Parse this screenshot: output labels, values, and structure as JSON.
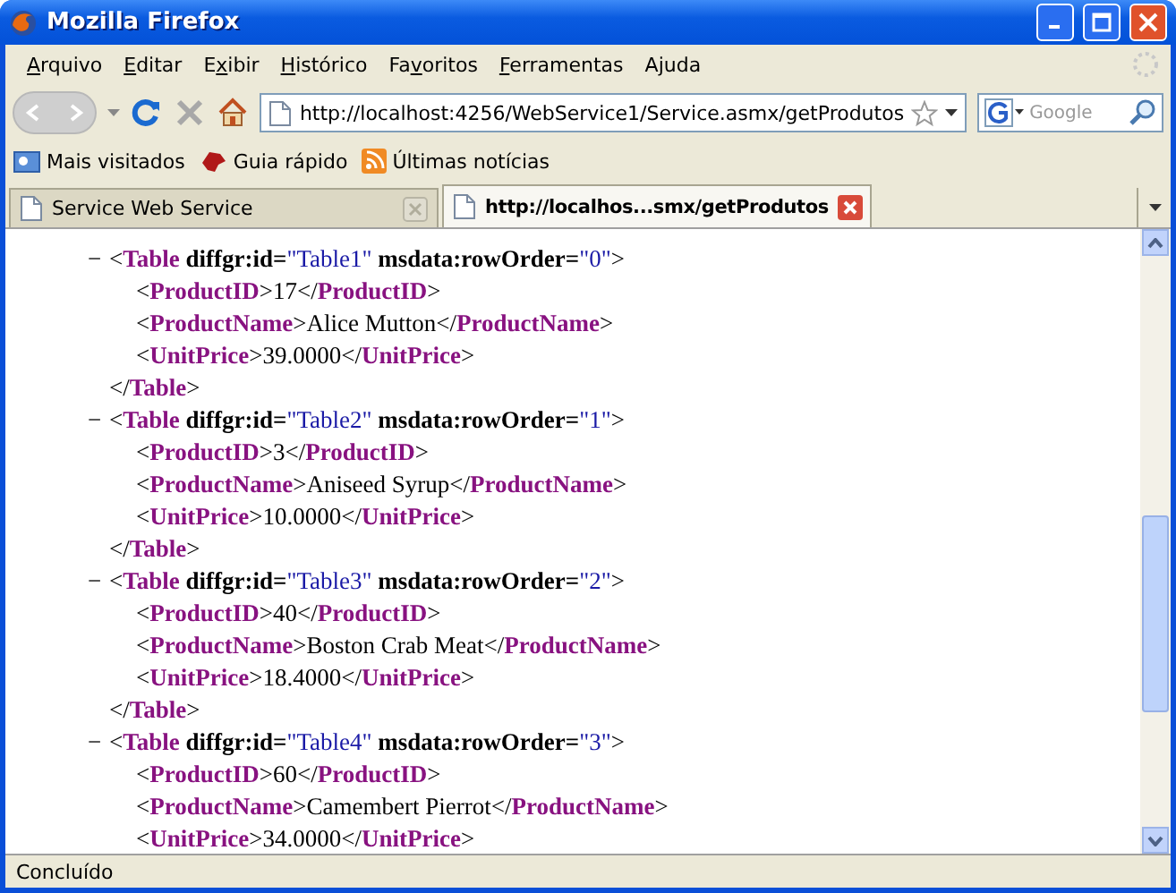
{
  "window": {
    "title": "Mozilla Firefox"
  },
  "menu": [
    {
      "key": "A",
      "post": "rquivo"
    },
    {
      "key": "E",
      "post": "ditar"
    },
    {
      "pre": "E",
      "key": "x",
      "post": "ibir"
    },
    {
      "key": "H",
      "post": "istórico"
    },
    {
      "pre": "Fa",
      "key": "v",
      "post": "oritos"
    },
    {
      "key": "F",
      "post": "erramentas"
    },
    {
      "pre": "A",
      "key": "j",
      "post": "uda"
    }
  ],
  "address_bar": {
    "value": "http://localhost:4256/WebService1/Service.asmx/getProdutos"
  },
  "search": {
    "placeholder": "Google"
  },
  "bookmarks": [
    {
      "label": "Mais visitados",
      "kind": "folder"
    },
    {
      "label": "Guia rápido",
      "kind": "guide"
    },
    {
      "label": "Últimas notícias",
      "kind": "feed"
    }
  ],
  "tabs": [
    {
      "label": "Service Web Service",
      "selected": false
    },
    {
      "label": "http://localhos...smx/getProdutos",
      "selected": true
    }
  ],
  "document": [
    {
      "toggle": "−",
      "open": [
        {
          "kind": "punct",
          "text": "<"
        },
        {
          "kind": "tag",
          "text": "Table"
        },
        {
          "kind": "attr",
          "text": " diffgr:id="
        },
        {
          "kind": "value",
          "text": "\"Table1\""
        },
        {
          "kind": "attr",
          "text": " msdata:rowOrder="
        },
        {
          "kind": "value",
          "text": "\"0\""
        },
        {
          "kind": "punct",
          "text": ">"
        }
      ],
      "children": [
        [
          {
            "kind": "punct",
            "text": "<"
          },
          {
            "kind": "tag",
            "text": "ProductID"
          },
          {
            "kind": "punct",
            "text": ">"
          },
          {
            "kind": "text",
            "text": "17"
          },
          {
            "kind": "punct",
            "text": "</"
          },
          {
            "kind": "tag",
            "text": "ProductID"
          },
          {
            "kind": "punct",
            "text": ">"
          }
        ],
        [
          {
            "kind": "punct",
            "text": "<"
          },
          {
            "kind": "tag",
            "text": "ProductName"
          },
          {
            "kind": "punct",
            "text": ">"
          },
          {
            "kind": "text",
            "text": "Alice Mutton"
          },
          {
            "kind": "punct",
            "text": "</"
          },
          {
            "kind": "tag",
            "text": "ProductName"
          },
          {
            "kind": "punct",
            "text": ">"
          }
        ],
        [
          {
            "kind": "punct",
            "text": "<"
          },
          {
            "kind": "tag",
            "text": "UnitPrice"
          },
          {
            "kind": "punct",
            "text": ">"
          },
          {
            "kind": "text",
            "text": "39.0000"
          },
          {
            "kind": "punct",
            "text": "</"
          },
          {
            "kind": "tag",
            "text": "UnitPrice"
          },
          {
            "kind": "punct",
            "text": ">"
          }
        ]
      ],
      "close": [
        {
          "kind": "punct",
          "text": "</"
        },
        {
          "kind": "tag",
          "text": "Table"
        },
        {
          "kind": "punct",
          "text": ">"
        }
      ]
    },
    {
      "toggle": "−",
      "open": [
        {
          "kind": "punct",
          "text": "<"
        },
        {
          "kind": "tag",
          "text": "Table"
        },
        {
          "kind": "attr",
          "text": " diffgr:id="
        },
        {
          "kind": "value",
          "text": "\"Table2\""
        },
        {
          "kind": "attr",
          "text": " msdata:rowOrder="
        },
        {
          "kind": "value",
          "text": "\"1\""
        },
        {
          "kind": "punct",
          "text": ">"
        }
      ],
      "children": [
        [
          {
            "kind": "punct",
            "text": "<"
          },
          {
            "kind": "tag",
            "text": "ProductID"
          },
          {
            "kind": "punct",
            "text": ">"
          },
          {
            "kind": "text",
            "text": "3"
          },
          {
            "kind": "punct",
            "text": "</"
          },
          {
            "kind": "tag",
            "text": "ProductID"
          },
          {
            "kind": "punct",
            "text": ">"
          }
        ],
        [
          {
            "kind": "punct",
            "text": "<"
          },
          {
            "kind": "tag",
            "text": "ProductName"
          },
          {
            "kind": "punct",
            "text": ">"
          },
          {
            "kind": "text",
            "text": "Aniseed Syrup"
          },
          {
            "kind": "punct",
            "text": "</"
          },
          {
            "kind": "tag",
            "text": "ProductName"
          },
          {
            "kind": "punct",
            "text": ">"
          }
        ],
        [
          {
            "kind": "punct",
            "text": "<"
          },
          {
            "kind": "tag",
            "text": "UnitPrice"
          },
          {
            "kind": "punct",
            "text": ">"
          },
          {
            "kind": "text",
            "text": "10.0000"
          },
          {
            "kind": "punct",
            "text": "</"
          },
          {
            "kind": "tag",
            "text": "UnitPrice"
          },
          {
            "kind": "punct",
            "text": ">"
          }
        ]
      ],
      "close": [
        {
          "kind": "punct",
          "text": "</"
        },
        {
          "kind": "tag",
          "text": "Table"
        },
        {
          "kind": "punct",
          "text": ">"
        }
      ]
    },
    {
      "toggle": "−",
      "open": [
        {
          "kind": "punct",
          "text": "<"
        },
        {
          "kind": "tag",
          "text": "Table"
        },
        {
          "kind": "attr",
          "text": " diffgr:id="
        },
        {
          "kind": "value",
          "text": "\"Table3\""
        },
        {
          "kind": "attr",
          "text": " msdata:rowOrder="
        },
        {
          "kind": "value",
          "text": "\"2\""
        },
        {
          "kind": "punct",
          "text": ">"
        }
      ],
      "children": [
        [
          {
            "kind": "punct",
            "text": "<"
          },
          {
            "kind": "tag",
            "text": "ProductID"
          },
          {
            "kind": "punct",
            "text": ">"
          },
          {
            "kind": "text",
            "text": "40"
          },
          {
            "kind": "punct",
            "text": "</"
          },
          {
            "kind": "tag",
            "text": "ProductID"
          },
          {
            "kind": "punct",
            "text": ">"
          }
        ],
        [
          {
            "kind": "punct",
            "text": "<"
          },
          {
            "kind": "tag",
            "text": "ProductName"
          },
          {
            "kind": "punct",
            "text": ">"
          },
          {
            "kind": "text",
            "text": "Boston Crab Meat"
          },
          {
            "kind": "punct",
            "text": "</"
          },
          {
            "kind": "tag",
            "text": "ProductName"
          },
          {
            "kind": "punct",
            "text": ">"
          }
        ],
        [
          {
            "kind": "punct",
            "text": "<"
          },
          {
            "kind": "tag",
            "text": "UnitPrice"
          },
          {
            "kind": "punct",
            "text": ">"
          },
          {
            "kind": "text",
            "text": "18.4000"
          },
          {
            "kind": "punct",
            "text": "</"
          },
          {
            "kind": "tag",
            "text": "UnitPrice"
          },
          {
            "kind": "punct",
            "text": ">"
          }
        ]
      ],
      "close": [
        {
          "kind": "punct",
          "text": "</"
        },
        {
          "kind": "tag",
          "text": "Table"
        },
        {
          "kind": "punct",
          "text": ">"
        }
      ]
    },
    {
      "toggle": "−",
      "open": [
        {
          "kind": "punct",
          "text": "<"
        },
        {
          "kind": "tag",
          "text": "Table"
        },
        {
          "kind": "attr",
          "text": " diffgr:id="
        },
        {
          "kind": "value",
          "text": "\"Table4\""
        },
        {
          "kind": "attr",
          "text": " msdata:rowOrder="
        },
        {
          "kind": "value",
          "text": "\"3\""
        },
        {
          "kind": "punct",
          "text": ">"
        }
      ],
      "children": [
        [
          {
            "kind": "punct",
            "text": "<"
          },
          {
            "kind": "tag",
            "text": "ProductID"
          },
          {
            "kind": "punct",
            "text": ">"
          },
          {
            "kind": "text",
            "text": "60"
          },
          {
            "kind": "punct",
            "text": "</"
          },
          {
            "kind": "tag",
            "text": "ProductID"
          },
          {
            "kind": "punct",
            "text": ">"
          }
        ],
        [
          {
            "kind": "punct",
            "text": "<"
          },
          {
            "kind": "tag",
            "text": "ProductName"
          },
          {
            "kind": "punct",
            "text": ">"
          },
          {
            "kind": "text",
            "text": "Camembert Pierrot"
          },
          {
            "kind": "punct",
            "text": "</"
          },
          {
            "kind": "tag",
            "text": "ProductName"
          },
          {
            "kind": "punct",
            "text": ">"
          }
        ],
        [
          {
            "kind": "punct",
            "text": "<"
          },
          {
            "kind": "tag",
            "text": "UnitPrice"
          },
          {
            "kind": "punct",
            "text": ">"
          },
          {
            "kind": "text",
            "text": "34.0000"
          },
          {
            "kind": "punct",
            "text": "</"
          },
          {
            "kind": "tag",
            "text": "UnitPrice"
          },
          {
            "kind": "punct",
            "text": ">"
          }
        ]
      ]
    }
  ],
  "status_bar": {
    "text": "Concluído"
  }
}
